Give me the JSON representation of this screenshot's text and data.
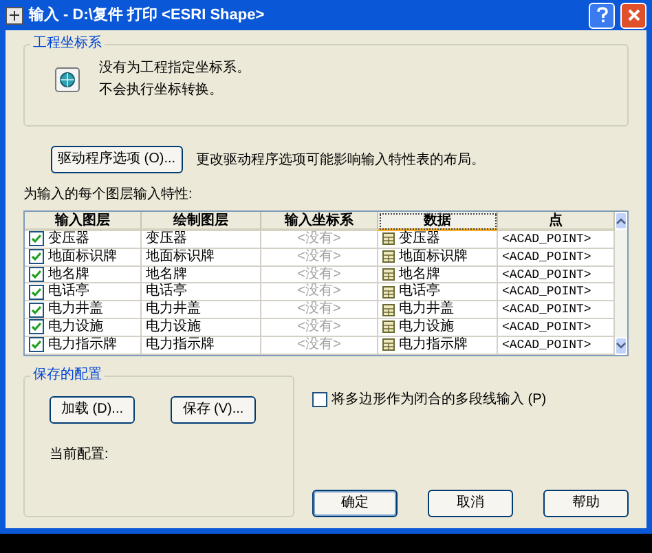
{
  "window": {
    "title": "输入 - D:\\复件 打印 <ESRI Shape>"
  },
  "coordinate_group": {
    "title": "工程坐标系",
    "lines": [
      "没有为工程指定坐标系。",
      "不会执行坐标转换。"
    ]
  },
  "driver_button": {
    "label": "驱动程序选项 (O)...",
    "note": "更改驱动程序选项可能影响输入特性表的布局。"
  },
  "table": {
    "caption": "为输入的每个图层输入特性:",
    "columns": [
      {
        "label": "输入图层",
        "selected": false
      },
      {
        "label": "绘制图层",
        "selected": false
      },
      {
        "label": "输入坐标系",
        "selected": false
      },
      {
        "label": "数据",
        "selected": true
      },
      {
        "label": "点",
        "selected": false
      }
    ],
    "rows": [
      {
        "checked": true,
        "layer": "变压器",
        "draw": "变压器",
        "coord": "<没有>",
        "data": "变压器",
        "point": "<ACAD_POINT>"
      },
      {
        "checked": true,
        "layer": "地面标识牌",
        "draw": "地面标识牌",
        "coord": "<没有>",
        "data": "地面标识牌",
        "point": "<ACAD_POINT>"
      },
      {
        "checked": true,
        "layer": "地名牌",
        "draw": "地名牌",
        "coord": "<没有>",
        "data": "地名牌",
        "point": "<ACAD_POINT>"
      },
      {
        "checked": true,
        "layer": "电话亭",
        "draw": "电话亭",
        "coord": "<没有>",
        "data": "电话亭",
        "point": "<ACAD_POINT>"
      },
      {
        "checked": true,
        "layer": "电力井盖",
        "draw": "电力井盖",
        "coord": "<没有>",
        "data": "电力井盖",
        "point": "<ACAD_POINT>"
      },
      {
        "checked": true,
        "layer": "电力设施",
        "draw": "电力设施",
        "coord": "<没有>",
        "data": "电力设施",
        "point": "<ACAD_POINT>"
      },
      {
        "checked": true,
        "layer": "电力指示牌",
        "draw": "电力指示牌",
        "coord": "<没有>",
        "data": "电力指示牌",
        "point": "<ACAD_POINT>"
      }
    ]
  },
  "config_group": {
    "title": "保存的配置",
    "load": "加载 (D)...",
    "save": "保存 (V)...",
    "current": "当前配置:"
  },
  "polygon_option": {
    "label": "将多边形作为闭合的多段线输入 (P)",
    "checked": false
  },
  "buttons": [
    "确定",
    "取消",
    "帮助"
  ]
}
